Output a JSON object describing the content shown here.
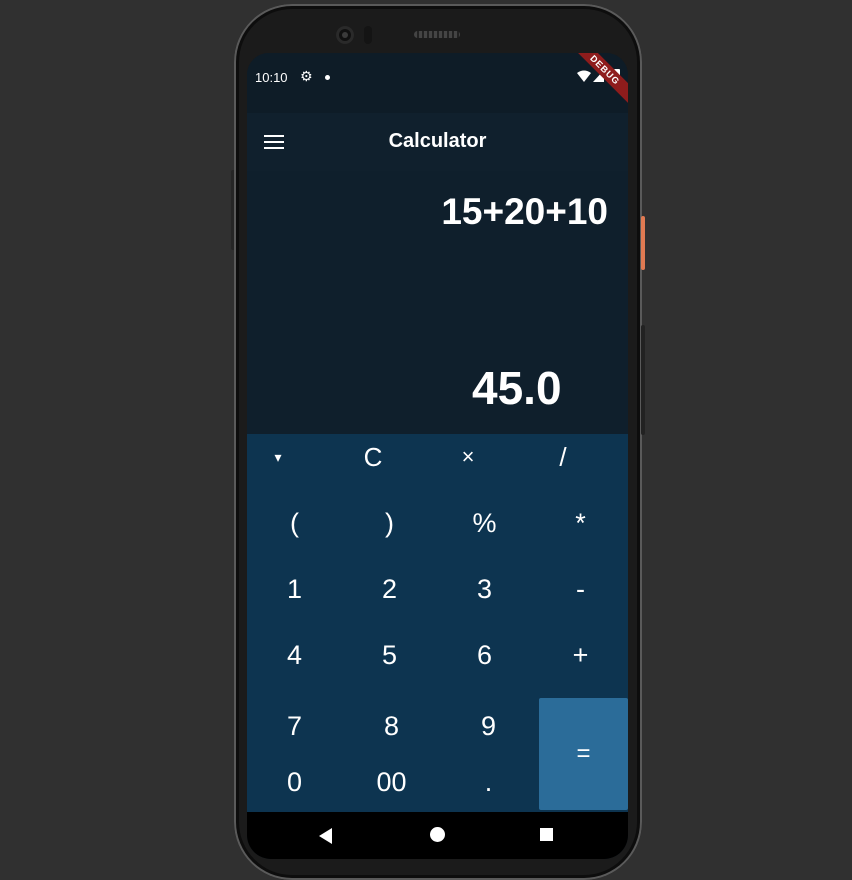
{
  "status_bar": {
    "time": "10:10",
    "icons": [
      "gear-icon",
      "notification-dot",
      "wifi-icon",
      "signal-icon",
      "battery-icon"
    ],
    "debug_banner": "DEBUG"
  },
  "app_bar": {
    "menu_icon": "hamburger-menu-icon",
    "title": "Calculator"
  },
  "display": {
    "expression": "15+20+10",
    "result": "45.0"
  },
  "keypad": {
    "rows": [
      [
        "▾",
        "C",
        "×",
        "/"
      ],
      [
        "(",
        ")",
        "%",
        "*"
      ],
      [
        "1",
        "2",
        "3",
        "-"
      ],
      [
        "4",
        "5",
        "6",
        "+"
      ],
      [
        "7",
        "8",
        "9"
      ],
      [
        "0",
        "00",
        "."
      ]
    ],
    "equals": "="
  },
  "nav_bar": {
    "icons": [
      "back-icon",
      "home-icon",
      "recents-icon"
    ]
  },
  "colors": {
    "background": "#303030",
    "display_bg": "#0f1f2c",
    "keypad_bg": "#0d3450",
    "equals_bg": "#2b6c99",
    "power_button": "#e07a52",
    "debug_banner": "#8e1c1c"
  }
}
